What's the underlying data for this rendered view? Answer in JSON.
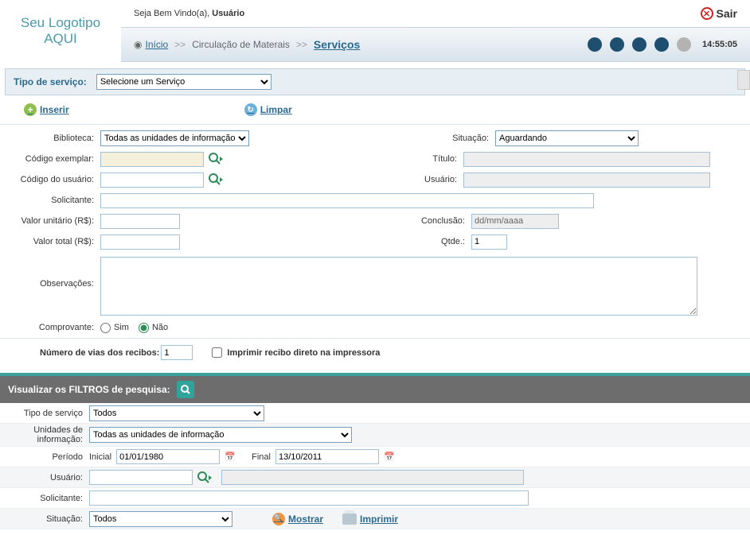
{
  "header": {
    "logo_line1": "Seu Logotipo",
    "logo_line2": "AQUI",
    "welcome_prefix": "Seja Bem Vindo(a), ",
    "user": "Usuário",
    "exit": "Sair",
    "time": "14:55:05"
  },
  "breadcrumb": {
    "home": "Início",
    "mid": "Circulação de Materais",
    "current": "Serviços",
    "sep": ">>"
  },
  "service_bar": {
    "label": "Tipo de serviço:",
    "selected": "Selecione um Serviço"
  },
  "actions": {
    "insert": "Inserir",
    "clear": "Limpar"
  },
  "form": {
    "biblioteca_label": "Biblioteca:",
    "biblioteca_value": "Todas as unidades de informação",
    "situacao_label": "Situação:",
    "situacao_value": "Aguardando",
    "codigo_exemplar_label": "Código exemplar:",
    "codigo_exemplar_value": "",
    "titulo_label": "Título:",
    "titulo_value": "",
    "codigo_usuario_label": "Código do usuário:",
    "codigo_usuario_value": "",
    "usuario_label": "Usuário:",
    "usuario_value": "",
    "solicitante_label": "Solicitante:",
    "solicitante_value": "",
    "valor_unitario_label": "Valor unitário (R$):",
    "valor_unitario_value": "",
    "conclusao_label": "Conclusão:",
    "conclusao_placeholder": "dd/mm/aaaa",
    "valor_total_label": "Valor total (R$):",
    "valor_total_value": "",
    "qtde_label": "Qtde.:",
    "qtde_value": "1",
    "observacoes_label": "Observações:",
    "observacoes_value": "",
    "comprovante_label": "Comprovante:",
    "comprovante_sim": "Sim",
    "comprovante_nao": "Não",
    "vias_label": "Número de vias dos recibos:",
    "vias_value": "1",
    "imprimir_direto": "Imprimir recibo direto na impressora"
  },
  "filters": {
    "header": "Visualizar os FILTROS de pesquisa:",
    "tipo_servico_label": "Tipo de serviço",
    "tipo_servico_value": "Todos",
    "unidades_label_l1": "Unidades de",
    "unidades_label_l2": "informação:",
    "unidades_value": "Todas as unidades de informação",
    "periodo_label": "Período",
    "inicial_label": "Inicial",
    "inicial_value": "01/01/1980",
    "final_label": "Final",
    "final_value": "13/10/2011",
    "usuario_label": "Usuário:",
    "usuario_value": "",
    "usuario_display": "",
    "solicitante_label": "Solicitante:",
    "solicitante_value": "",
    "situacao_label": "Situação:",
    "situacao_value": "Todos",
    "mostrar": "Mostrar",
    "imprimir": "Imprimir"
  }
}
